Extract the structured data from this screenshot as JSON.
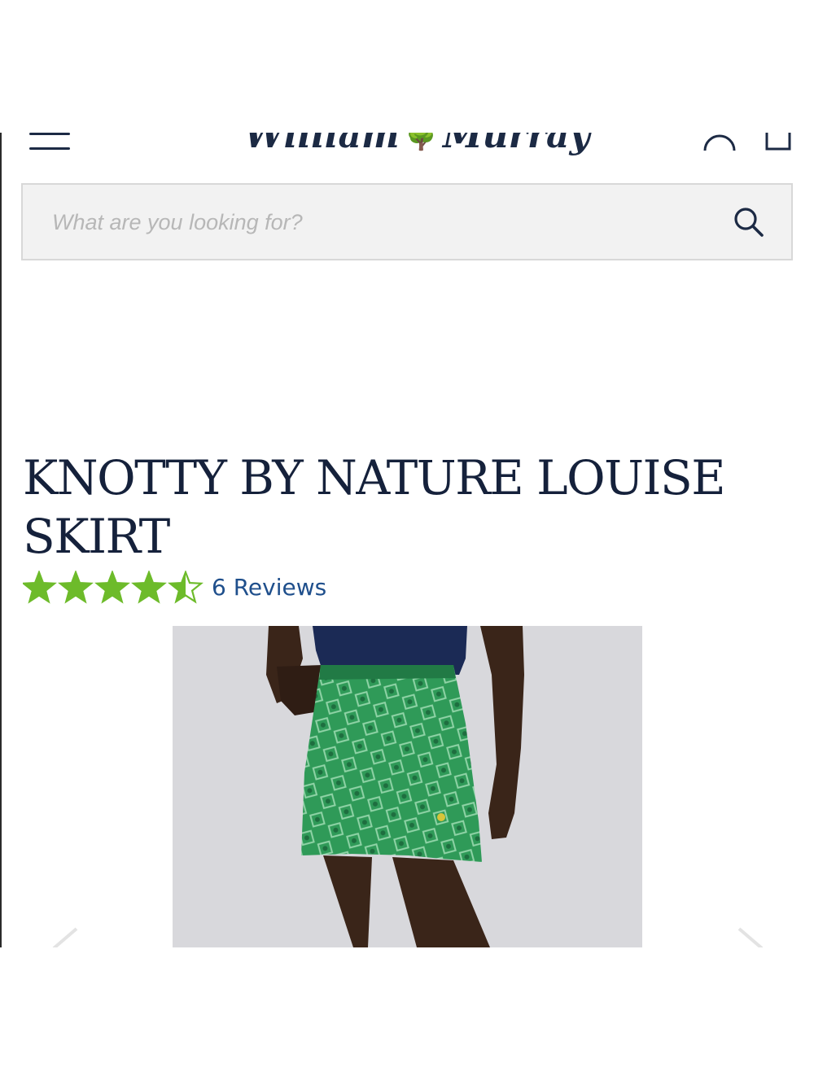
{
  "header": {
    "logo_text_left": "William",
    "logo_text_right": "Murray",
    "menu_icon": "hamburger-menu-icon",
    "account_icon": "account-icon",
    "cart_icon": "cart-icon"
  },
  "search": {
    "placeholder": "What are you looking for?",
    "value": "",
    "icon": "search-icon"
  },
  "product": {
    "title": "KNOTTY BY NATURE LOUISE SKIRT",
    "rating": 4.5,
    "rating_max": 5,
    "reviews_label": "6 Reviews",
    "image_alt": "Model wearing green patterned skirt with navy top"
  },
  "carousel": {
    "prev_icon": "chevron-left-icon",
    "next_icon": "chevron-right-icon"
  },
  "colors": {
    "navy": "#15213b",
    "star_green": "#6dbb2a",
    "link_blue": "#1f4f8c",
    "skirt_green": "#2f9a58"
  }
}
